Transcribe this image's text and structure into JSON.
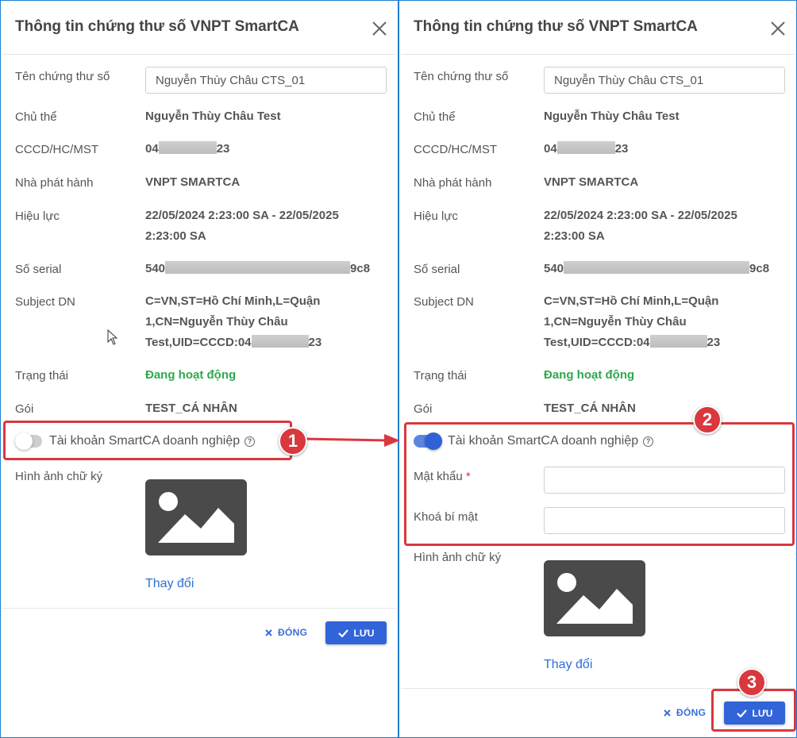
{
  "dialog": {
    "title": "Thông tin chứng thư số VNPT SmartCA",
    "fields": {
      "cert_name_label": "Tên chứng thư số",
      "cert_name_value": "Nguyễn Thùy Châu CTS_01",
      "subject_label": "Chủ thể",
      "subject_value": "Nguyễn Thùy Châu Test",
      "id_label": "CCCD/HC/MST",
      "id_prefix": "04",
      "id_suffix": "23",
      "issuer_label": "Nhà phát hành",
      "issuer_value": "VNPT SMARTCA",
      "validity_label": "Hiệu lực",
      "validity_line1": "22/05/2024 2:23:00 SA - 22/05/2025",
      "validity_line2": "2:23:00 SA",
      "serial_label": "Số serial",
      "serial_prefix": "540",
      "serial_suffix": "9c8",
      "serial_suffix_left": "9c8",
      "dn_label": "Subject DN",
      "dn_line1": "C=VN,ST=Hồ Chí Minh,L=Quận",
      "dn_line2": "1,CN=Nguyễn Thùy Châu",
      "dn_line3_prefix": "Test,UID=CCCD:04",
      "dn_line3_suffix": "23",
      "status_label": "Trạng thái",
      "status_value": "Đang hoạt động",
      "package_label": "Gói",
      "package_value": "TEST_CÁ NHÂN",
      "toggle_label": "Tài khoản SmartCA doanh nghiệp",
      "password_label": "Mật khẩu",
      "required_mark": "*",
      "secret_label": "Khoá bí mật",
      "signature_label": "Hình ảnh chữ ký",
      "change_link": "Thay đổi"
    },
    "buttons": {
      "close_label": "ĐÓNG",
      "save_label": "LƯU"
    }
  },
  "left_panel": {
    "toggle_on": false
  },
  "right_panel": {
    "toggle_on": true
  },
  "annotations": {
    "step1": "1",
    "step2": "2",
    "step3": "3"
  },
  "colors": {
    "accent": "#3264d9",
    "status_active": "#2fa84f",
    "annotation_red": "#d9383e"
  }
}
